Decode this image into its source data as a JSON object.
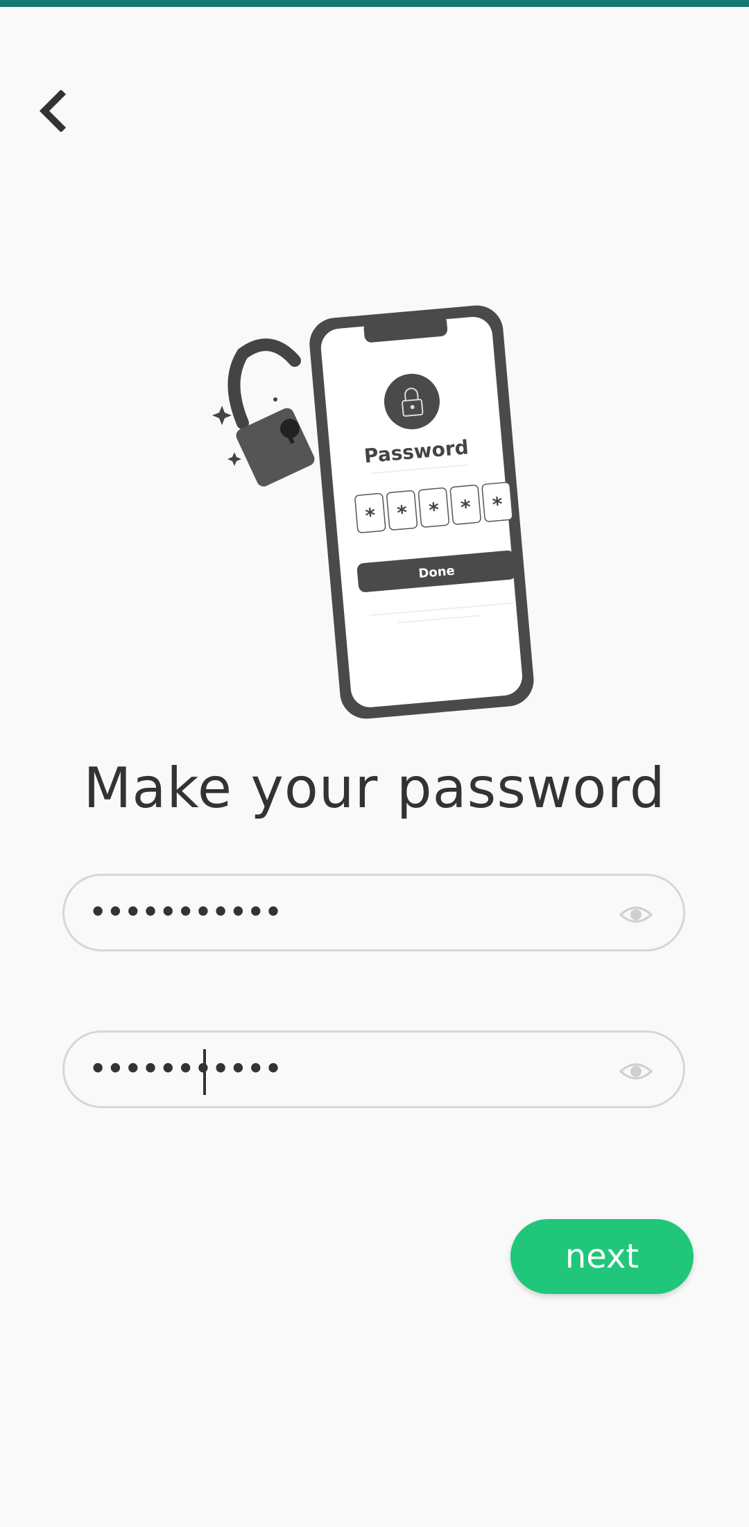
{
  "screen": {
    "heading": "Make your password",
    "accent_color": "#20c77a",
    "status_strip_color": "#137a6f"
  },
  "illustration": {
    "title": "Password",
    "pin_chars": [
      "*",
      "*",
      "*",
      "*",
      "*"
    ],
    "done_label": "Done"
  },
  "fields": [
    {
      "value": "•••••••••••",
      "icon": "eye-icon",
      "focused": false
    },
    {
      "value": "•••••••••••",
      "icon": "eye-icon",
      "focused": true
    }
  ],
  "actions": {
    "back_icon": "chevron-left-icon",
    "next_label": "next"
  }
}
